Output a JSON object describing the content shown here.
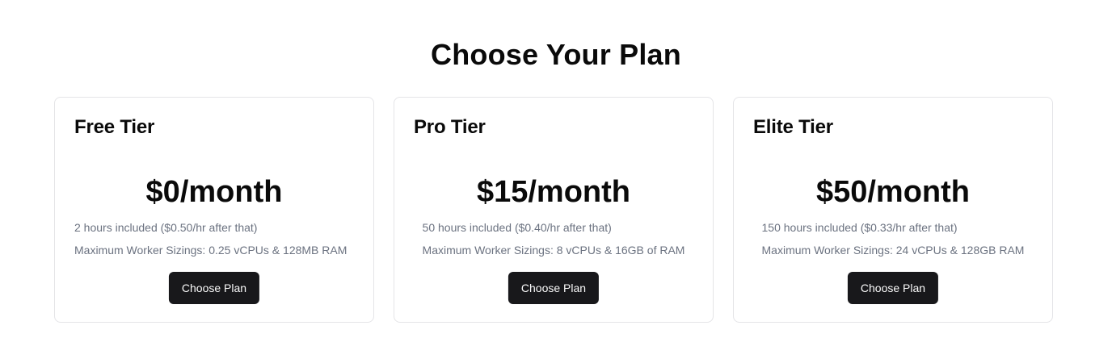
{
  "page": {
    "title": "Choose Your Plan"
  },
  "plans": [
    {
      "name": "Free Tier",
      "price": "$0/month",
      "hours": "2 hours included ($0.50/hr after that)",
      "sizing": "Maximum Worker Sizings: 0.25 vCPUs & 128MB RAM",
      "button_label": "Choose Plan"
    },
    {
      "name": "Pro Tier",
      "price": "$15/month",
      "hours": "50 hours included ($0.40/hr after that)",
      "sizing": "Maximum Worker Sizings: 8 vCPUs & 16GB of RAM",
      "button_label": "Choose Plan"
    },
    {
      "name": "Elite Tier",
      "price": "$50/month",
      "hours": "150 hours included ($0.33/hr after that)",
      "sizing": "Maximum Worker Sizings: 24 vCPUs & 128GB RAM",
      "button_label": "Choose Plan"
    }
  ],
  "colors": {
    "button_bg": "#18181b",
    "button_text": "#fafafa",
    "muted_text": "#6b7280",
    "card_border": "#e4e4e7"
  }
}
